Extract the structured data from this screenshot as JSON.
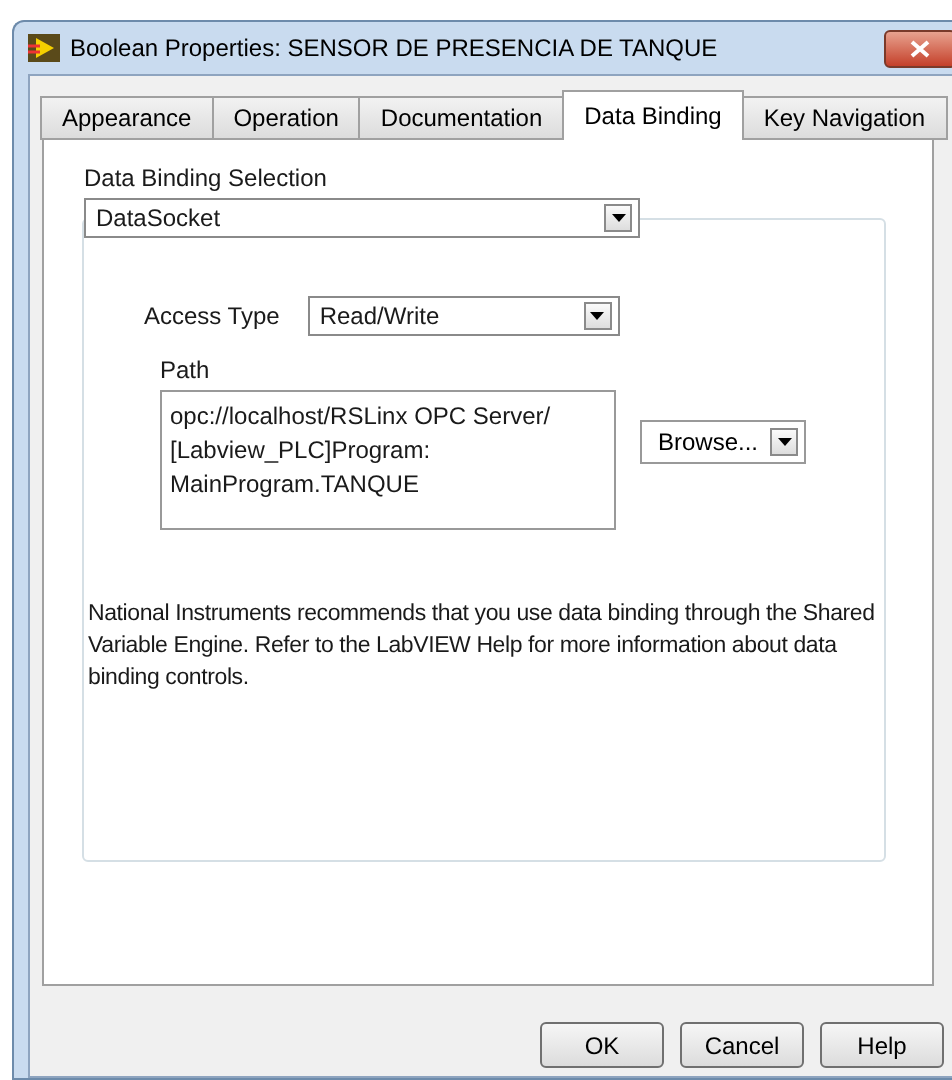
{
  "window": {
    "title": "Boolean Properties: SENSOR DE PRESENCIA DE TANQUE"
  },
  "tabs": [
    {
      "label": "Appearance",
      "selected": false
    },
    {
      "label": "Operation",
      "selected": false
    },
    {
      "label": "Documentation",
      "selected": false
    },
    {
      "label": "Data Binding",
      "selected": true
    },
    {
      "label": "Key Navigation",
      "selected": false
    }
  ],
  "data_binding_selection": {
    "label": "Data Binding Selection",
    "value": "DataSocket"
  },
  "access_type": {
    "label": "Access Type",
    "value": "Read/Write"
  },
  "path": {
    "label": "Path",
    "lines": [
      "opc://localhost/RSLinx OPC Server/",
      "[Labview_PLC]Program:",
      "MainProgram.TANQUE"
    ],
    "browse": "Browse..."
  },
  "note": "National Instruments recommends that you use data binding through the Shared Variable Engine.  Refer to the LabVIEW Help for more information about data binding controls.",
  "buttons": [
    "OK",
    "Cancel",
    "Help"
  ]
}
